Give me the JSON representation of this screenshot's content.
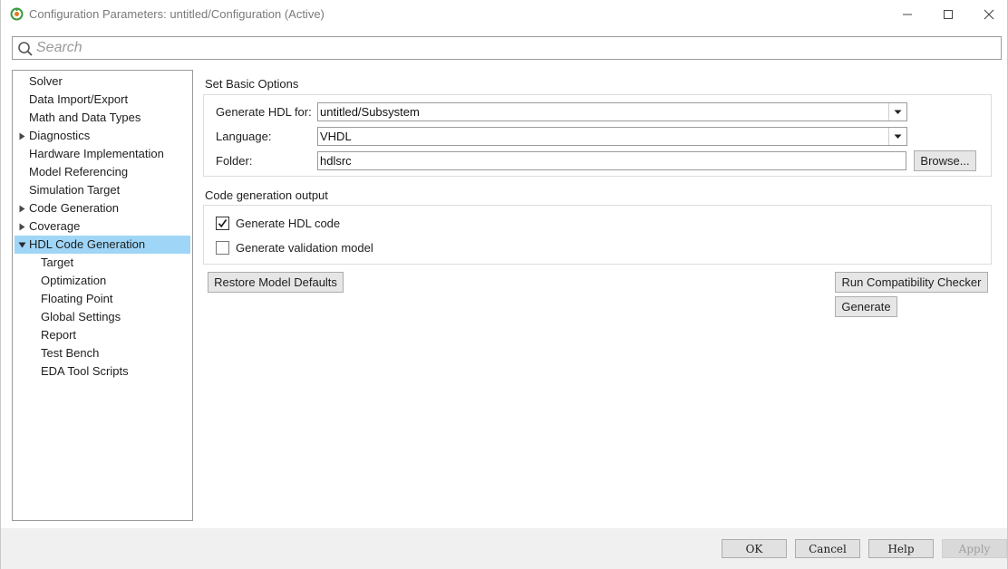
{
  "window": {
    "title": "Configuration Parameters: untitled/Configuration (Active)"
  },
  "search": {
    "placeholder": "Search"
  },
  "tree": {
    "items": [
      {
        "label": "Solver",
        "level": 1,
        "expandable": false
      },
      {
        "label": "Data Import/Export",
        "level": 1,
        "expandable": false
      },
      {
        "label": "Math and Data Types",
        "level": 1,
        "expandable": false
      },
      {
        "label": "Diagnostics",
        "level": 1,
        "expandable": true,
        "expanded": false
      },
      {
        "label": "Hardware Implementation",
        "level": 1,
        "expandable": false
      },
      {
        "label": "Model Referencing",
        "level": 1,
        "expandable": false
      },
      {
        "label": "Simulation Target",
        "level": 1,
        "expandable": false
      },
      {
        "label": "Code Generation",
        "level": 1,
        "expandable": true,
        "expanded": false
      },
      {
        "label": "Coverage",
        "level": 1,
        "expandable": true,
        "expanded": false
      },
      {
        "label": "HDL Code Generation",
        "level": 1,
        "expandable": true,
        "expanded": true,
        "selected": true
      },
      {
        "label": "Target",
        "level": 2,
        "expandable": false
      },
      {
        "label": "Optimization",
        "level": 2,
        "expandable": false
      },
      {
        "label": "Floating Point",
        "level": 2,
        "expandable": false
      },
      {
        "label": "Global Settings",
        "level": 2,
        "expandable": false
      },
      {
        "label": "Report",
        "level": 2,
        "expandable": false
      },
      {
        "label": "Test Bench",
        "level": 2,
        "expandable": false
      },
      {
        "label": "EDA Tool Scripts",
        "level": 2,
        "expandable": false
      }
    ]
  },
  "basic_options": {
    "title": "Set Basic Options",
    "generate_for_label": "Generate HDL for:",
    "generate_for_value": "untitled/Subsystem",
    "language_label": "Language:",
    "language_value": "VHDL",
    "folder_label": "Folder:",
    "folder_value": "hdlsrc",
    "browse_label": "Browse..."
  },
  "output": {
    "title": "Code generation output",
    "generate_hdl_label": "Generate HDL code",
    "generate_hdl_checked": true,
    "generate_validation_label": "Generate validation model",
    "generate_validation_checked": false
  },
  "actions": {
    "restore_label": "Restore Model Defaults",
    "compat_label": "Run Compatibility Checker",
    "generate_label": "Generate"
  },
  "footer": {
    "ok_label": "OK",
    "cancel_label": "Cancel",
    "help_label": "Help",
    "apply_label": "Apply"
  },
  "colors": {
    "selection": "#9fd6f7",
    "button_face": "#e6e6e6",
    "border": "#9b9b9b"
  }
}
